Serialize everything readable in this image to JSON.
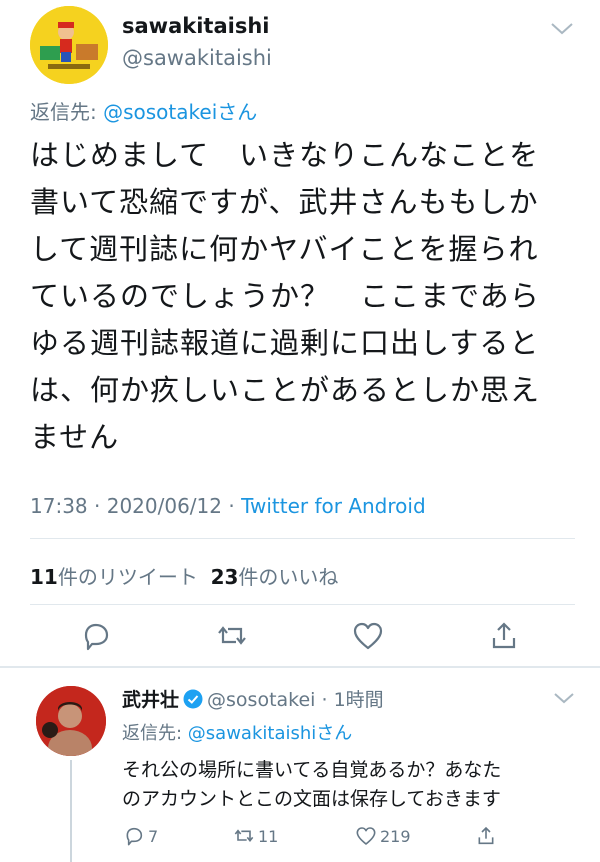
{
  "main_tweet": {
    "display_name": "sawakitaishi",
    "handle": "@sawakitaishi",
    "reply_to_prefix": "返信先: ",
    "reply_to_mention": "@sosotakei",
    "reply_to_suffix": "さん",
    "body_lines": [
      "はじめまして　いきなりこんなことを",
      "書いて恐縮ですが、武井さんももしか",
      "して週刊誌に何かヤバイことを握られ",
      "ているのでしょうか？　ここまであら",
      "ゆる週刊誌報道に過剰に口出しすると",
      "は、何か疚しいことがあるとしか思え",
      "ません"
    ],
    "time": "17:38",
    "date": "2020/06/12",
    "source": "Twitter for Android",
    "retweet_count": "11",
    "retweet_label": "件のリツイート",
    "like_count": "23",
    "like_label": "件のいいね",
    "actions": [
      "reply-icon",
      "retweet-icon",
      "like-icon",
      "share-icon"
    ]
  },
  "reply_tweet": {
    "display_name": "武井壮",
    "handle": "@sosotakei",
    "time_ago": "1時間",
    "reply_to_prefix": "返信先: ",
    "reply_to_mention": "@sawakitaishi",
    "reply_to_suffix": "さん",
    "body_lines": [
      "それ公の場所に書いてる自覚あるか？あなた",
      "のアカウントとこの文面は保存しておきます"
    ],
    "reply_count": "7",
    "retweet_count": "11",
    "like_count": "219"
  },
  "colors": {
    "link": "#1b95e0",
    "secondary_text": "#657786",
    "divider": "#e1e8ed",
    "verified": "#1da1f2"
  }
}
